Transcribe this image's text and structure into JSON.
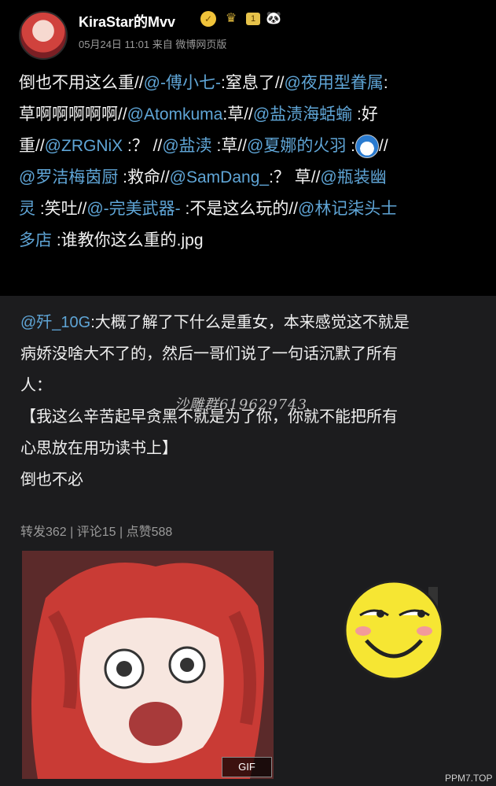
{
  "header": {
    "username": "KiraStar的Mvv",
    "level": "1",
    "meta": "05月24日 11:01  来自 微博网页版"
  },
  "post": {
    "segments": [
      {
        "t": "倒也不用这么重//",
        "m": false
      },
      {
        "t": "@-傅小七-",
        "m": true
      },
      {
        "t": ":窒息了//",
        "m": false
      },
      {
        "t": "@夜用型眷属",
        "m": true
      },
      {
        "t": ":\n草啊啊啊啊啊//",
        "m": false
      },
      {
        "t": "@Atomkuma",
        "m": true
      },
      {
        "t": ":草//",
        "m": false
      },
      {
        "t": "@盐渍海蛞蝓",
        "m": true
      },
      {
        "t": " :好\n重//",
        "m": false
      },
      {
        "t": "@ZRGNiX",
        "m": true
      },
      {
        "t": " :？ //",
        "m": false
      },
      {
        "t": "@盐渎",
        "m": true
      },
      {
        "t": " :草//",
        "m": false
      },
      {
        "t": "@夏娜的火羽",
        "m": true
      },
      {
        "t": " :[EMOJI]//\n",
        "m": false
      },
      {
        "t": "@罗洁梅茵厨",
        "m": true
      },
      {
        "t": " :救命//",
        "m": false
      },
      {
        "t": "@SamDang_",
        "m": true
      },
      {
        "t": ":？ 草//",
        "m": false
      },
      {
        "t": "@瓶装幽\n灵",
        "m": true
      },
      {
        "t": " :笑吐//",
        "m": false
      },
      {
        "t": "@-完美武器-",
        "m": true
      },
      {
        "t": " :不是这么玩的//",
        "m": false
      },
      {
        "t": "@林记柒头士\n多店",
        "m": true
      },
      {
        "t": " :谁教你这么重的.jpg",
        "m": false
      }
    ]
  },
  "repost": {
    "author": "@歼_10G",
    "body_line1": ":大概了解了下什么是重女，本来感觉这不就是",
    "body_line2": "病娇没啥大不了的，然后一哥们说了一句话沉默了所有",
    "body_line3": "人：",
    "quote_line1": "【我这么辛苦起早贪黑不就是为了你，你就不能把所有",
    "quote_line2": "心思放在用功读书上】",
    "closing": "倒也不必",
    "watermark": "沙雕群619629743",
    "stats": "转发362 | 评论15 | 点赞588",
    "gif_label": "GIF"
  },
  "site_mark": "PPM7.TOP"
}
